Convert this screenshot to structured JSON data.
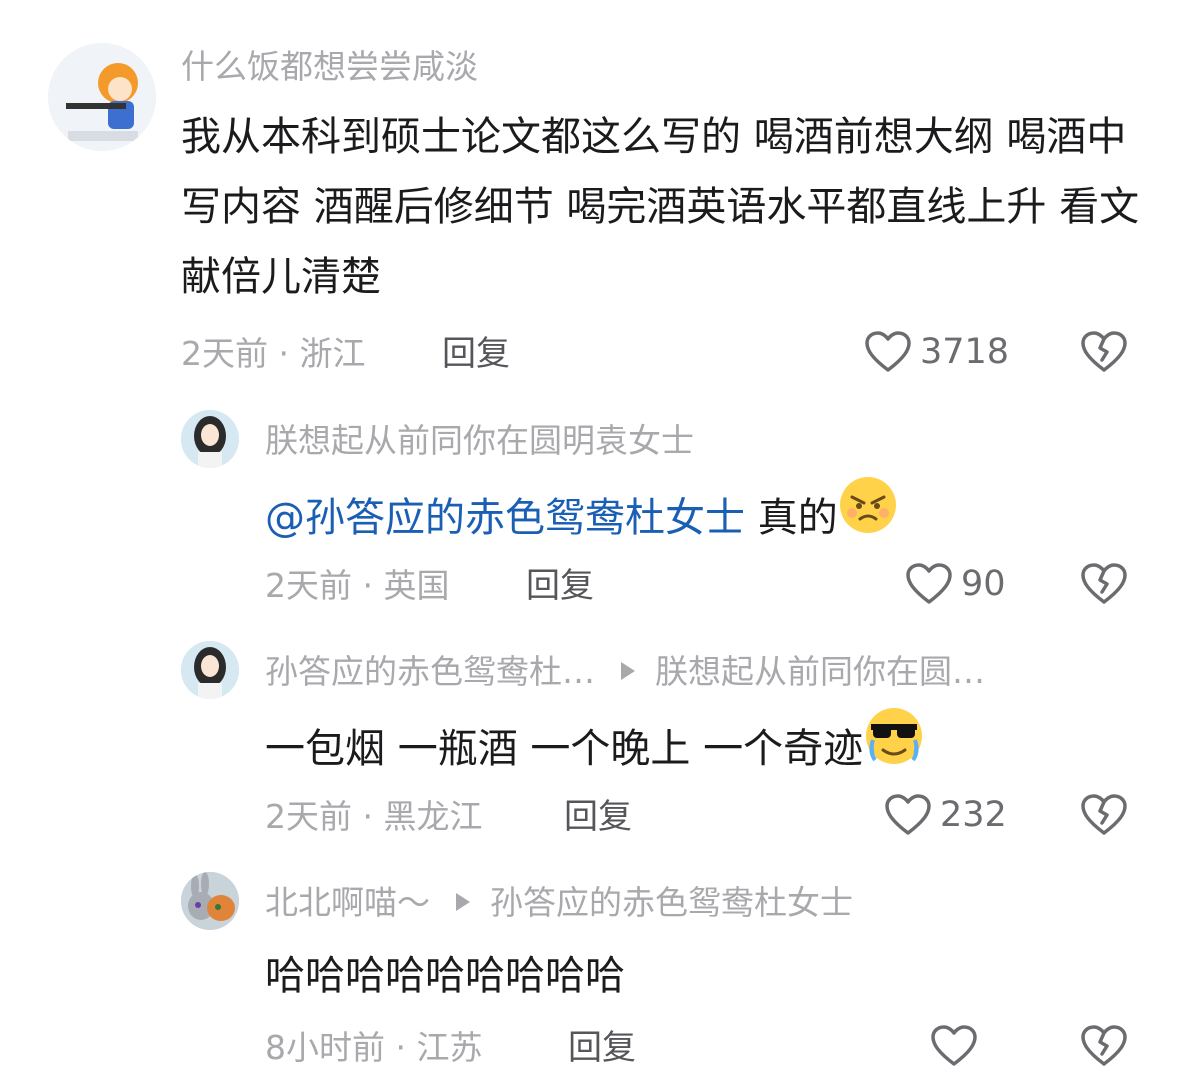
{
  "comments": [
    {
      "username": "什么饭都想尝尝咸淡",
      "body": "我从本科到硕士论文都这么写的 喝酒前想大纲 喝酒中写内容 酒醒后修细节 喝完酒英语水平都直线上升 看文献倍儿清楚",
      "time": "2天前",
      "location": "浙江",
      "reply_label": "回复",
      "likes": "3718"
    },
    {
      "username": "朕想起从前同你在圆明袁女士",
      "mention": "@孙答应的赤色鸳鸯杜女士",
      "body": "真的",
      "time": "2天前",
      "location": "英国",
      "reply_label": "回复",
      "likes": "90"
    },
    {
      "username": "孙答应的赤色鸳鸯杜…",
      "reply_to": "朕想起从前同你在圆…",
      "body": "一包烟 一瓶酒 一个晚上 一个奇迹",
      "time": "2天前",
      "location": "黑龙江",
      "reply_label": "回复",
      "likes": "232"
    },
    {
      "username": "北北啊喵～",
      "reply_to": "孙答应的赤色鸳鸯杜女士",
      "body": "哈哈哈哈哈哈哈哈哈",
      "time": "8小时前",
      "location": "江苏",
      "reply_label": "回复"
    }
  ],
  "separator": " · ",
  "icons": {
    "like": "heart-outline-icon",
    "dislike": "broken-heart-icon",
    "reply_arrow": "play-triangle-icon"
  },
  "colors": {
    "username": "#a9a9ad",
    "mention": "#1a5fb4",
    "body": "#1b1b1d"
  }
}
